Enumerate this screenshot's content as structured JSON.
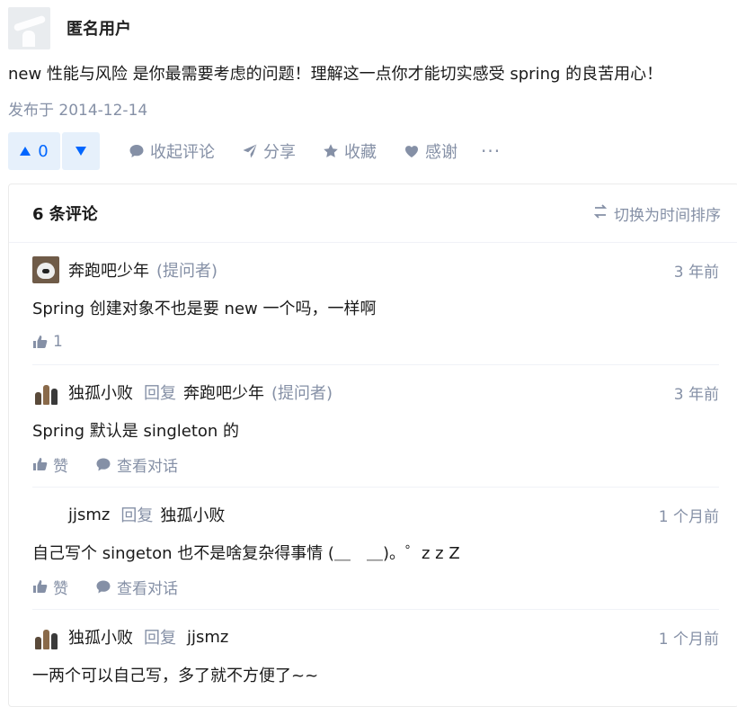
{
  "answer": {
    "author": "匿名用户",
    "content": "new 性能与风险 是你最需要考虑的问题！理解这一点你才能切实感受 spring 的良苦用心！",
    "published": "发布于 2014-12-14"
  },
  "actions": {
    "upvote_count": "0",
    "collapse_comments": "收起评论",
    "share": "分享",
    "favorite": "收藏",
    "thanks": "感谢",
    "more": "···"
  },
  "comments": {
    "count_label": "6 条评论",
    "sort_label": "切换为时间排序",
    "items": [
      {
        "user": "奔跑吧少年",
        "role": "(提问者)",
        "reply_word": "",
        "reply_to": "",
        "reply_role": "",
        "time": "3 年前",
        "text": "Spring 创建对象不也是要 new 一个吗，一样啊",
        "like": "1",
        "view_conversation": ""
      },
      {
        "user": "独孤小败",
        "role": "",
        "reply_word": "回复",
        "reply_to": "奔跑吧少年",
        "reply_role": "(提问者)",
        "time": "3 年前",
        "text": "Spring 默认是 singleton 的",
        "like": "赞",
        "view_conversation": "查看对话"
      },
      {
        "user": "jjsmz",
        "role": "",
        "reply_word": "回复",
        "reply_to": "独孤小败",
        "reply_role": "",
        "time": "1 个月前",
        "text": "自己写个 singeton 也不是啥复杂得事情 (＿　＿)。゜z z Z",
        "like": "赞",
        "view_conversation": "查看对话"
      },
      {
        "user": "独孤小败",
        "role": "",
        "reply_word": "回复",
        "reply_to": "jjsmz",
        "reply_role": "",
        "time": "1 个月前",
        "text": "一两个可以自己写，多了就不方便了~~",
        "like": "",
        "view_conversation": ""
      }
    ]
  },
  "colors": {
    "accent": "#0066ff",
    "accent_bg": "#e6f0fb",
    "muted": "#8590a6"
  }
}
